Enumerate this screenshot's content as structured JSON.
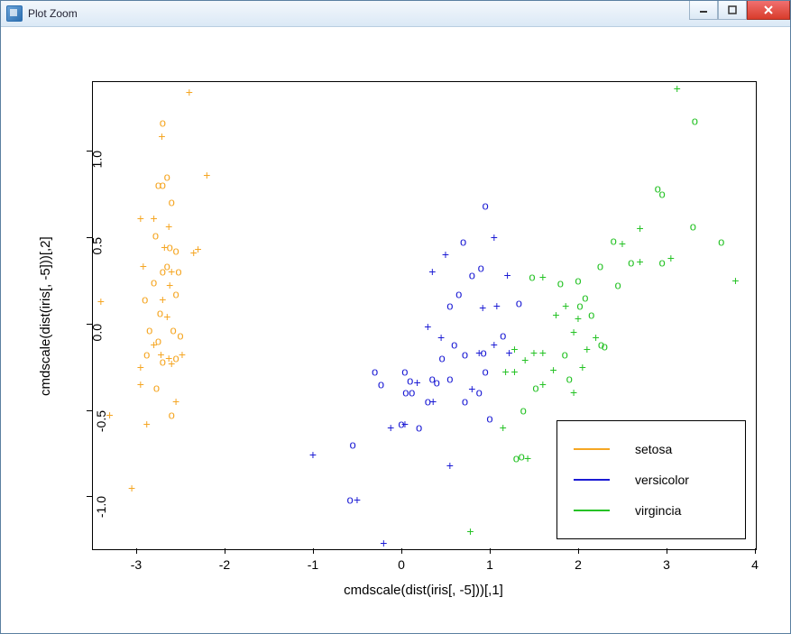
{
  "window": {
    "title": "Plot Zoom"
  },
  "chart_data": {
    "type": "scatter",
    "xlabel": "cmdscale(dist(iris[, -5]))[,1]",
    "ylabel": "cmdscale(dist(iris[, -5]))[,2]",
    "xlim": [
      -3.5,
      4.0
    ],
    "ylim": [
      -1.3,
      1.4
    ],
    "xticks": [
      -3,
      -2,
      -1,
      0,
      1,
      2,
      3,
      4
    ],
    "yticks": [
      -1.0,
      -0.5,
      0.0,
      0.5,
      1.0
    ],
    "series": [
      {
        "name": "setosa",
        "color": "#f5a623",
        "markers": [
          "o",
          "+"
        ],
        "points": [
          {
            "x": -2.4,
            "y": 1.34,
            "m": "+"
          },
          {
            "x": -2.7,
            "y": 1.16,
            "m": "o"
          },
          {
            "x": -2.71,
            "y": 1.08,
            "m": "+"
          },
          {
            "x": -2.65,
            "y": 0.85,
            "m": "o"
          },
          {
            "x": -2.7,
            "y": 0.8,
            "m": "o"
          },
          {
            "x": -2.75,
            "y": 0.8,
            "m": "o"
          },
          {
            "x": -2.2,
            "y": 0.86,
            "m": "+"
          },
          {
            "x": -2.6,
            "y": 0.7,
            "m": "o"
          },
          {
            "x": -2.8,
            "y": 0.61,
            "m": "+"
          },
          {
            "x": -2.95,
            "y": 0.61,
            "m": "+"
          },
          {
            "x": -2.63,
            "y": 0.56,
            "m": "+"
          },
          {
            "x": -2.78,
            "y": 0.51,
            "m": "o"
          },
          {
            "x": -2.55,
            "y": 0.42,
            "m": "o"
          },
          {
            "x": -2.62,
            "y": 0.44,
            "m": "o"
          },
          {
            "x": -2.68,
            "y": 0.44,
            "m": "+"
          },
          {
            "x": -2.3,
            "y": 0.43,
            "m": "+"
          },
          {
            "x": -2.35,
            "y": 0.41,
            "m": "+"
          },
          {
            "x": -2.92,
            "y": 0.33,
            "m": "+"
          },
          {
            "x": -2.65,
            "y": 0.33,
            "m": "o"
          },
          {
            "x": -2.7,
            "y": 0.3,
            "m": "o"
          },
          {
            "x": -2.6,
            "y": 0.3,
            "m": "+"
          },
          {
            "x": -2.52,
            "y": 0.3,
            "m": "o"
          },
          {
            "x": -2.8,
            "y": 0.24,
            "m": "o"
          },
          {
            "x": -2.62,
            "y": 0.22,
            "m": "+"
          },
          {
            "x": -2.55,
            "y": 0.17,
            "m": "o"
          },
          {
            "x": -2.7,
            "y": 0.14,
            "m": "+"
          },
          {
            "x": -2.9,
            "y": 0.14,
            "m": "o"
          },
          {
            "x": -3.4,
            "y": 0.13,
            "m": "+"
          },
          {
            "x": -2.73,
            "y": 0.06,
            "m": "o"
          },
          {
            "x": -2.65,
            "y": 0.04,
            "m": "+"
          },
          {
            "x": -2.85,
            "y": -0.04,
            "m": "o"
          },
          {
            "x": -2.58,
            "y": -0.04,
            "m": "o"
          },
          {
            "x": -2.5,
            "y": -0.07,
            "m": "o"
          },
          {
            "x": -2.75,
            "y": -0.1,
            "m": "o"
          },
          {
            "x": -2.8,
            "y": -0.12,
            "m": "+"
          },
          {
            "x": -2.88,
            "y": -0.18,
            "m": "o"
          },
          {
            "x": -2.72,
            "y": -0.18,
            "m": "+"
          },
          {
            "x": -2.63,
            "y": -0.2,
            "m": "+"
          },
          {
            "x": -2.55,
            "y": -0.2,
            "m": "o"
          },
          {
            "x": -2.7,
            "y": -0.22,
            "m": "o"
          },
          {
            "x": -2.6,
            "y": -0.23,
            "m": "+"
          },
          {
            "x": -2.48,
            "y": -0.18,
            "m": "+"
          },
          {
            "x": -2.95,
            "y": -0.35,
            "m": "+"
          },
          {
            "x": -2.77,
            "y": -0.37,
            "m": "o"
          },
          {
            "x": -3.3,
            "y": -0.53,
            "m": "+"
          },
          {
            "x": -2.88,
            "y": -0.58,
            "m": "+"
          },
          {
            "x": -2.6,
            "y": -0.53,
            "m": "o"
          },
          {
            "x": -2.55,
            "y": -0.45,
            "m": "+"
          },
          {
            "x": -3.05,
            "y": -0.95,
            "m": "+"
          },
          {
            "x": -2.95,
            "y": -0.25,
            "m": "+"
          }
        ]
      },
      {
        "name": "versicolor",
        "color": "#1b1bd4",
        "markers": [
          "o",
          "+"
        ],
        "points": [
          {
            "x": 0.95,
            "y": 0.68,
            "m": "o"
          },
          {
            "x": 0.7,
            "y": 0.47,
            "m": "o"
          },
          {
            "x": 1.05,
            "y": 0.5,
            "m": "+"
          },
          {
            "x": 0.5,
            "y": 0.4,
            "m": "+"
          },
          {
            "x": 0.9,
            "y": 0.32,
            "m": "o"
          },
          {
            "x": 0.8,
            "y": 0.28,
            "m": "o"
          },
          {
            "x": 0.65,
            "y": 0.17,
            "m": "o"
          },
          {
            "x": 1.2,
            "y": 0.28,
            "m": "+"
          },
          {
            "x": 1.08,
            "y": 0.1,
            "m": "+"
          },
          {
            "x": 0.92,
            "y": 0.09,
            "m": "+"
          },
          {
            "x": 1.33,
            "y": 0.12,
            "m": "o"
          },
          {
            "x": 0.35,
            "y": 0.3,
            "m": "+"
          },
          {
            "x": 0.55,
            "y": 0.1,
            "m": "o"
          },
          {
            "x": 0.3,
            "y": -0.02,
            "m": "+"
          },
          {
            "x": 0.6,
            "y": -0.12,
            "m": "o"
          },
          {
            "x": 0.88,
            "y": -0.17,
            "m": "+"
          },
          {
            "x": 0.93,
            "y": -0.17,
            "m": "o"
          },
          {
            "x": 1.05,
            "y": -0.12,
            "m": "+"
          },
          {
            "x": 1.0,
            "y": -0.55,
            "m": "o"
          },
          {
            "x": 0.72,
            "y": -0.18,
            "m": "o"
          },
          {
            "x": 0.46,
            "y": -0.2,
            "m": "o"
          },
          {
            "x": 0.1,
            "y": -0.33,
            "m": "o"
          },
          {
            "x": 0.04,
            "y": -0.28,
            "m": "o"
          },
          {
            "x": 0.35,
            "y": -0.32,
            "m": "o"
          },
          {
            "x": 0.18,
            "y": -0.34,
            "m": "+"
          },
          {
            "x": 0.4,
            "y": -0.34,
            "m": "o"
          },
          {
            "x": 0.12,
            "y": -0.4,
            "m": "o"
          },
          {
            "x": 0.05,
            "y": -0.4,
            "m": "o"
          },
          {
            "x": -0.23,
            "y": -0.35,
            "m": "o"
          },
          {
            "x": -0.3,
            "y": -0.28,
            "m": "o"
          },
          {
            "x": 0.3,
            "y": -0.45,
            "m": "o"
          },
          {
            "x": 0.36,
            "y": -0.45,
            "m": "+"
          },
          {
            "x": 0.04,
            "y": -0.58,
            "m": "+"
          },
          {
            "x": 0.2,
            "y": -0.6,
            "m": "o"
          },
          {
            "x": -0.12,
            "y": -0.6,
            "m": "+"
          },
          {
            "x": 0.0,
            "y": -0.58,
            "m": "o"
          },
          {
            "x": 0.55,
            "y": -0.82,
            "m": "+"
          },
          {
            "x": -0.55,
            "y": -0.7,
            "m": "o"
          },
          {
            "x": -1.0,
            "y": -0.76,
            "m": "+"
          },
          {
            "x": -0.58,
            "y": -1.02,
            "m": "o"
          },
          {
            "x": -0.5,
            "y": -1.02,
            "m": "+"
          },
          {
            "x": -0.2,
            "y": -1.27,
            "m": "+"
          },
          {
            "x": 0.45,
            "y": -0.08,
            "m": "+"
          },
          {
            "x": 0.8,
            "y": -0.38,
            "m": "+"
          },
          {
            "x": 0.72,
            "y": -0.45,
            "m": "o"
          },
          {
            "x": 0.88,
            "y": -0.4,
            "m": "o"
          },
          {
            "x": 0.55,
            "y": -0.32,
            "m": "o"
          },
          {
            "x": 1.15,
            "y": -0.07,
            "m": "o"
          },
          {
            "x": 1.22,
            "y": -0.17,
            "m": "+"
          },
          {
            "x": 0.95,
            "y": -0.28,
            "m": "o"
          }
        ]
      },
      {
        "name": "virgincia",
        "color": "#25c225",
        "markers": [
          "o",
          "+"
        ],
        "points": [
          {
            "x": 3.12,
            "y": 1.36,
            "m": "+"
          },
          {
            "x": 3.32,
            "y": 1.17,
            "m": "o"
          },
          {
            "x": 2.9,
            "y": 0.78,
            "m": "o"
          },
          {
            "x": 2.95,
            "y": 0.75,
            "m": "o"
          },
          {
            "x": 2.7,
            "y": 0.55,
            "m": "+"
          },
          {
            "x": 3.3,
            "y": 0.56,
            "m": "o"
          },
          {
            "x": 3.62,
            "y": 0.47,
            "m": "o"
          },
          {
            "x": 2.4,
            "y": 0.48,
            "m": "o"
          },
          {
            "x": 2.5,
            "y": 0.46,
            "m": "+"
          },
          {
            "x": 2.25,
            "y": 0.33,
            "m": "o"
          },
          {
            "x": 2.6,
            "y": 0.35,
            "m": "o"
          },
          {
            "x": 2.95,
            "y": 0.35,
            "m": "o"
          },
          {
            "x": 3.05,
            "y": 0.38,
            "m": "+"
          },
          {
            "x": 3.78,
            "y": 0.25,
            "m": "+"
          },
          {
            "x": 2.0,
            "y": 0.25,
            "m": "o"
          },
          {
            "x": 1.8,
            "y": 0.23,
            "m": "o"
          },
          {
            "x": 1.6,
            "y": 0.27,
            "m": "+"
          },
          {
            "x": 1.48,
            "y": 0.27,
            "m": "o"
          },
          {
            "x": 2.15,
            "y": 0.05,
            "m": "o"
          },
          {
            "x": 2.0,
            "y": 0.03,
            "m": "+"
          },
          {
            "x": 2.08,
            "y": 0.15,
            "m": "o"
          },
          {
            "x": 2.02,
            "y": 0.1,
            "m": "o"
          },
          {
            "x": 1.86,
            "y": 0.1,
            "m": "+"
          },
          {
            "x": 1.75,
            "y": 0.05,
            "m": "+"
          },
          {
            "x": 1.95,
            "y": -0.05,
            "m": "+"
          },
          {
            "x": 2.2,
            "y": -0.08,
            "m": "+"
          },
          {
            "x": 2.26,
            "y": -0.12,
            "m": "o"
          },
          {
            "x": 2.1,
            "y": -0.15,
            "m": "+"
          },
          {
            "x": 2.3,
            "y": -0.13,
            "m": "o"
          },
          {
            "x": 1.85,
            "y": -0.18,
            "m": "o"
          },
          {
            "x": 1.9,
            "y": -0.32,
            "m": "o"
          },
          {
            "x": 1.6,
            "y": -0.17,
            "m": "+"
          },
          {
            "x": 1.5,
            "y": -0.17,
            "m": "+"
          },
          {
            "x": 1.28,
            "y": -0.15,
            "m": "+"
          },
          {
            "x": 1.4,
            "y": -0.21,
            "m": "+"
          },
          {
            "x": 1.28,
            "y": -0.28,
            "m": "+"
          },
          {
            "x": 1.18,
            "y": -0.28,
            "m": "+"
          },
          {
            "x": 1.52,
            "y": -0.37,
            "m": "o"
          },
          {
            "x": 1.6,
            "y": -0.35,
            "m": "+"
          },
          {
            "x": 1.95,
            "y": -0.4,
            "m": "+"
          },
          {
            "x": 1.38,
            "y": -0.5,
            "m": "o"
          },
          {
            "x": 1.15,
            "y": -0.6,
            "m": "+"
          },
          {
            "x": 1.3,
            "y": -0.78,
            "m": "o"
          },
          {
            "x": 1.36,
            "y": -0.77,
            "m": "o"
          },
          {
            "x": 1.43,
            "y": -0.78,
            "m": "+"
          },
          {
            "x": 0.78,
            "y": -1.2,
            "m": "+"
          },
          {
            "x": 2.45,
            "y": 0.22,
            "m": "o"
          },
          {
            "x": 2.7,
            "y": 0.36,
            "m": "+"
          },
          {
            "x": 2.05,
            "y": -0.25,
            "m": "+"
          },
          {
            "x": 1.72,
            "y": -0.27,
            "m": "+"
          }
        ]
      }
    ],
    "legend": {
      "position": "bottomright",
      "items": [
        {
          "label": "setosa",
          "color": "#f5a623"
        },
        {
          "label": "versicolor",
          "color": "#1b1bd4"
        },
        {
          "label": "virgincia",
          "color": "#25c225"
        }
      ]
    }
  }
}
